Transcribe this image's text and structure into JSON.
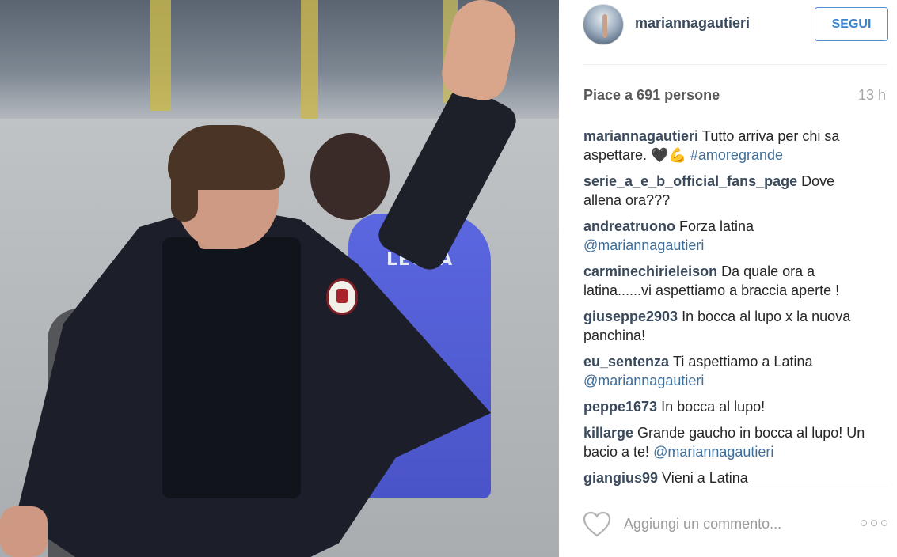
{
  "post": {
    "username": "mariannagautieri",
    "follow_label": "SEGUI",
    "likes_text": "Piace a 691 persone",
    "time_ago": "13 h",
    "photo_text": "LEGEA"
  },
  "comments": [
    {
      "user": "mariannagautieri",
      "text": "Tutto arriva per chi sa aspettare. 🖤💪",
      "tag": "#amoregrande"
    },
    {
      "user": "serie_a_e_b_official_fans_page",
      "text": "Dove allena ora???",
      "tag": ""
    },
    {
      "user": "andreatruono",
      "text": "Forza latina",
      "tag": "@mariannagautieri"
    },
    {
      "user": "carminechirieleison",
      "text": "Da quale ora a latina......vi aspettiamo a braccia aperte !",
      "tag": ""
    },
    {
      "user": "giuseppe2903",
      "text": "In bocca al lupo x la nuova panchina!",
      "tag": ""
    },
    {
      "user": "eu_sentenza",
      "text": "Ti aspettiamo a Latina",
      "tag": "@mariannagautieri"
    },
    {
      "user": "peppe1673",
      "text": "In bocca al lupo!",
      "tag": ""
    },
    {
      "user": "killarge",
      "text": "Grande gaucho in bocca al lupo! Un bacio a te!",
      "tag": "@mariannagautieri"
    },
    {
      "user": "giangius99",
      "text": "Vieni a Latina",
      "tag": ""
    }
  ],
  "footer": {
    "comment_placeholder": "Aggiungi un commento..."
  }
}
